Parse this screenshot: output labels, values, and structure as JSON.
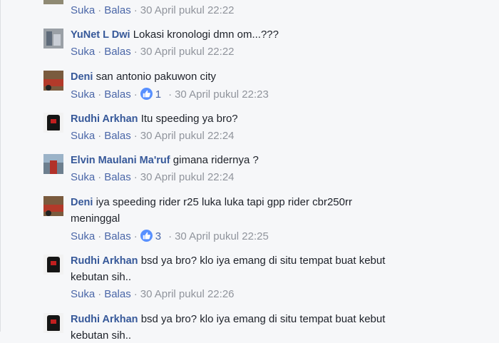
{
  "actions": {
    "like": "Suka",
    "reply": "Balas",
    "sep": "·"
  },
  "comments": [
    {
      "author": "",
      "text": "",
      "time": "30 April pukul 22:22",
      "likes": ""
    },
    {
      "author": "YuNet L Dwi",
      "text": "Lokasi kronologi dmn om...???",
      "time": "30 April pukul 22:22",
      "likes": ""
    },
    {
      "author": "Deni",
      "text": "san antonio pakuwon city",
      "time": "30 April pukul 22:23",
      "likes": "1"
    },
    {
      "author": "Rudhi Arkhan",
      "text": "Itu speeding ya bro?",
      "time": "30 April pukul 22:24",
      "likes": ""
    },
    {
      "author": "Elvin Maulani Ma'ruf",
      "text": "gimana ridernya ?",
      "time": "30 April pukul 22:24",
      "likes": ""
    },
    {
      "author": "Deni",
      "text": "iya speeding rider r25 luka luka tapi gpp rider cbr250rr",
      "text2": "meninggal",
      "time": "30 April pukul 22:25",
      "likes": "3"
    },
    {
      "author": "Rudhi Arkhan",
      "text": "bsd ya bro? klo iya emang di situ tempat buat kebut",
      "text2": "kebutan sih..",
      "time": "30 April pukul 22:26",
      "likes": ""
    },
    {
      "author": "Rudhi Arkhan",
      "text": "bsd ya bro? klo iya emang di situ tempat buat kebut",
      "text2": "kebutan sih..",
      "time": "",
      "likes": ""
    }
  ],
  "icons": {
    "like_badge": "thumbs-up-icon",
    "like_badge_color": "#5890ff"
  }
}
